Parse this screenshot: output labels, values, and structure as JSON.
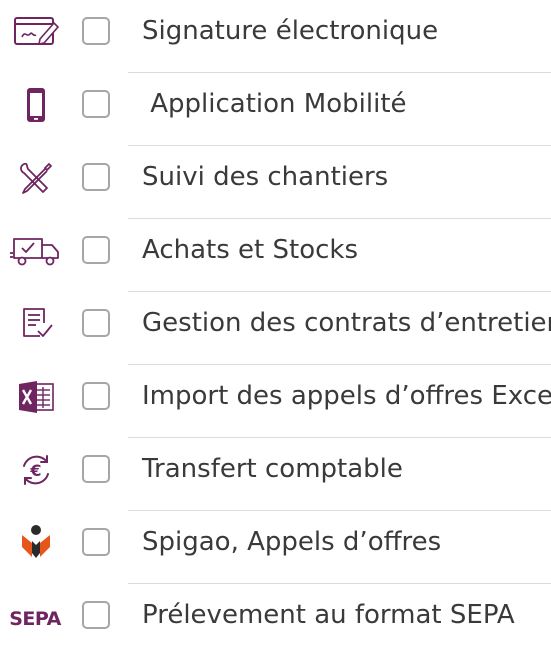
{
  "colors": {
    "accent": "#6e2560",
    "orange": "#e8551a",
    "text": "#3a3a3a",
    "checkbox_border": "#a6a6a6",
    "divider": "#dcdcdc"
  },
  "options": [
    {
      "label": "Signature électronique",
      "icon": "signature-icon",
      "checked": false
    },
    {
      "label": " Application Mobilité",
      "icon": "mobile-phone-icon",
      "checked": false
    },
    {
      "label": "Suivi des chantiers",
      "icon": "tools-icon",
      "checked": false
    },
    {
      "label": "Achats et Stocks",
      "icon": "delivery-truck-icon",
      "checked": false
    },
    {
      "label": "Gestion des contrats d’entretien",
      "icon": "contract-checklist-icon",
      "checked": false
    },
    {
      "label": "Import des appels d’offres Excel",
      "icon": "excel-icon",
      "checked": false
    },
    {
      "label": "Transfert comptable",
      "icon": "euro-transfer-icon",
      "checked": false
    },
    {
      "label": "Spigao, Appels d’offres",
      "icon": "spigao-logo-icon",
      "checked": false
    },
    {
      "label": "Prélevement au format SEPA",
      "icon": "sepa-logo-icon",
      "icon_text": "SEPA",
      "checked": false
    }
  ]
}
